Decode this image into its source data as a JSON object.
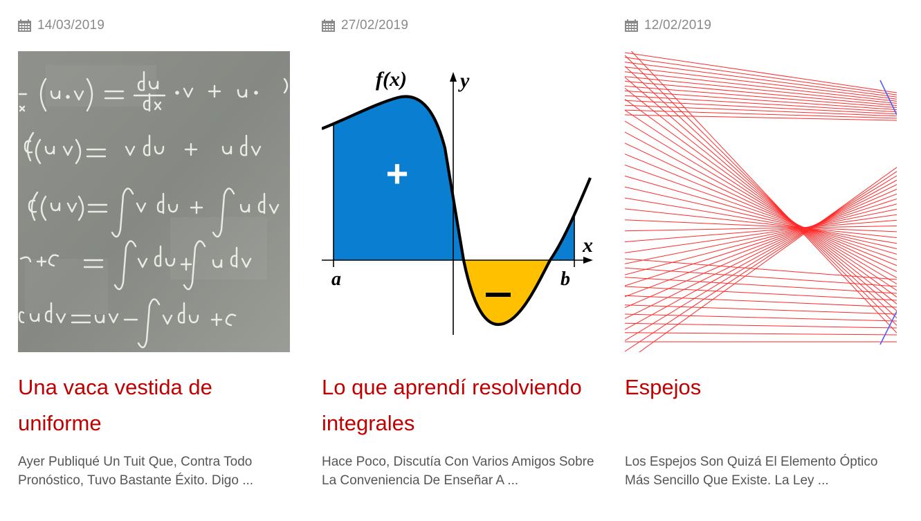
{
  "posts": [
    {
      "date": "14/03/2019",
      "title": "Una vaca vestida de uniforme",
      "excerpt": "Ayer Publiqué Un Tuit Que, Contra Todo Pronóstico, Tuvo Bastante Éxito. Digo ...",
      "image_icon": "chalkboard-integration-by-parts-image"
    },
    {
      "date": "27/02/2019",
      "title": "Lo que aprendí resolviendo integrales",
      "excerpt": "Hace Poco, Discutía Con Varios Amigos Sobre La Conveniencia De Enseñar A ...",
      "image_icon": "signed-area-integral-graph-image",
      "graph_labels": {
        "function": "f(x)",
        "y_axis": "y",
        "x_axis": "x",
        "a": "a",
        "b": "b",
        "plus": "+",
        "minus": "−"
      },
      "colors": {
        "positive_area": "#0a7fd1",
        "negative_area": "#ffc000"
      }
    },
    {
      "date": "12/02/2019",
      "title": "Espejos",
      "excerpt": "Los Espejos Son Quizá El Elemento Óptico Más Sencillo Que Existe. La Ley ...",
      "image_icon": "mirror-ray-caustic-image",
      "colors": {
        "rays": "#ff2a2a",
        "mirror": "#4a5cff"
      }
    }
  ],
  "theme": {
    "title_color": "#c00000",
    "date_color": "#8a8a8a",
    "excerpt_color": "#555555"
  }
}
